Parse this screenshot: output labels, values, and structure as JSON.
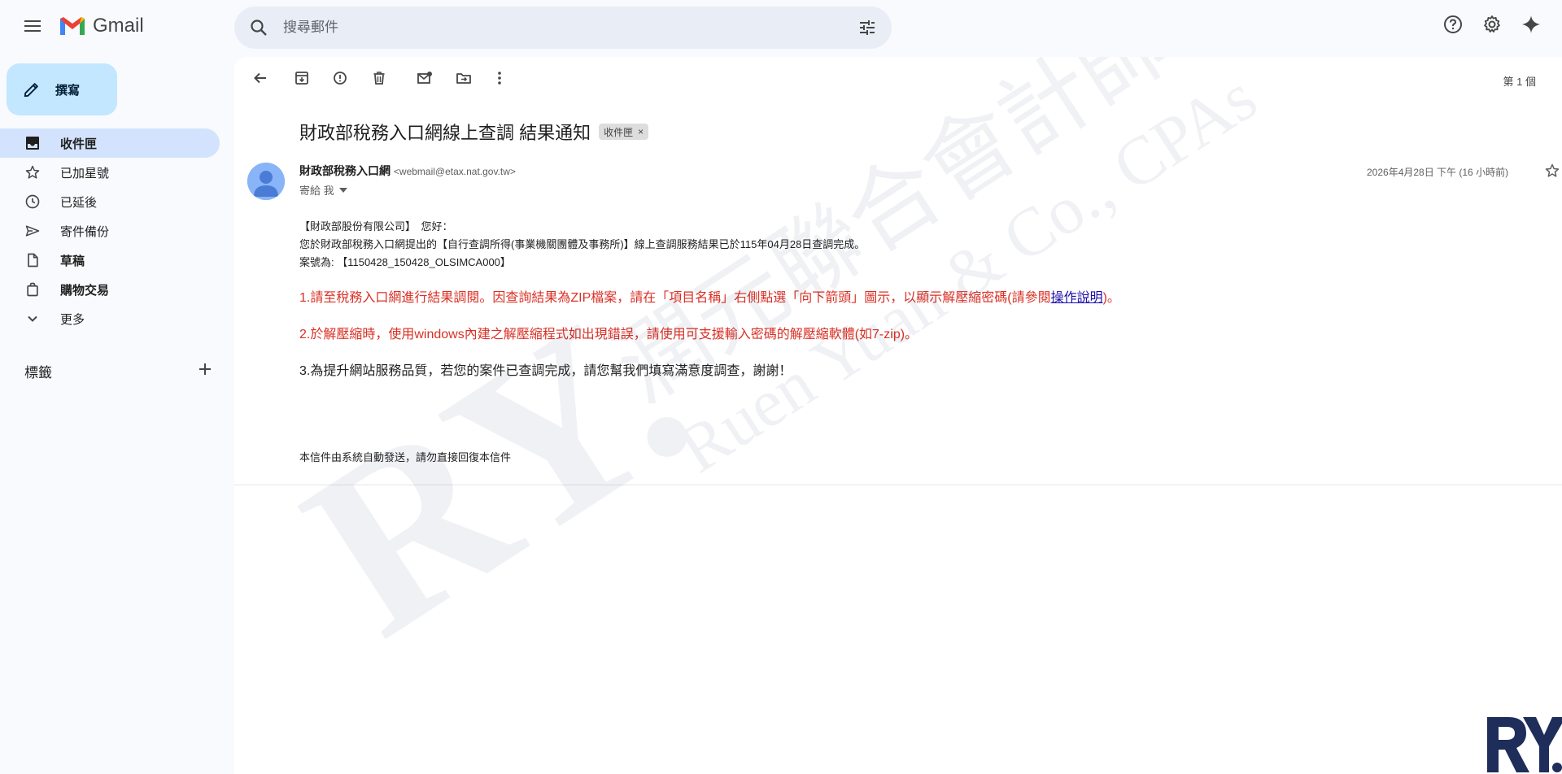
{
  "app": {
    "brand": "Gmail"
  },
  "search": {
    "placeholder": "搜尋郵件"
  },
  "sidebar": {
    "compose_label": "撰寫",
    "items": [
      {
        "label": "收件匣",
        "icon": "inbox-icon",
        "active": true
      },
      {
        "label": "已加星號",
        "icon": "star-icon",
        "active": false
      },
      {
        "label": "已延後",
        "icon": "clock-icon",
        "active": false
      },
      {
        "label": "寄件備份",
        "icon": "send-icon",
        "active": false
      },
      {
        "label": "草稿",
        "icon": "draft-icon",
        "active": false
      },
      {
        "label": "購物交易",
        "icon": "shopping-bag-icon",
        "active": false
      },
      {
        "label": "更多",
        "icon": "chevron-down-icon",
        "active": false
      }
    ],
    "labels_heading": "標籤"
  },
  "toolbar": {
    "page_count": "第 1 個"
  },
  "email": {
    "subject": "財政部稅務入口網線上查調 結果通知",
    "chip_label": "收件匣",
    "sender_name": "財政部稅務入口網",
    "sender_email": "<webmail@etax.nat.gov.tw>",
    "to_label": "寄給 我",
    "date": "2026年4月28日 下午 (16 小時前)",
    "greeting": "【財政部股份有限公司】　您好：",
    "line1": "您於財政部稅務入口網提出的【自行查調所得(事業機關團體及事務所)】線上查調服務結果已於115年04月28日查調完成。",
    "case_no": "案號為: 【1150428_150428_OLSIMCA000】",
    "red1_prefix": "1.請至稅務入口網進行結果調閱。因查詢結果為ZIP檔案，請在「項目名稱」右側點選「向下箭頭」圖示，以顯示解壓縮密碼(請參閱",
    "red1_link": "操作說明",
    "red1_suffix": ")。",
    "red2": "2.於解壓縮時，使用windows內建之解壓縮程式如出現錯誤，請使用可支援輸入密碼的解壓縮軟體(如7-zip)。",
    "line3": "3.為提升網站服務品質，若您的案件已查調完成，請您幫我們填寫滿意度調查，謝謝！",
    "footer": "本信件由系統自動發送，請勿直接回復本信件"
  },
  "watermark": {
    "chinese": "潤元聯合會計師事務所",
    "english": "Ruen Yuan & Co., CPAs",
    "logo": "RY."
  },
  "colors": {
    "compose_bg": "#c2e7ff",
    "active_nav": "#d3e3fd",
    "alert_red": "#d93025",
    "logo_navy": "#1e2d5a"
  }
}
